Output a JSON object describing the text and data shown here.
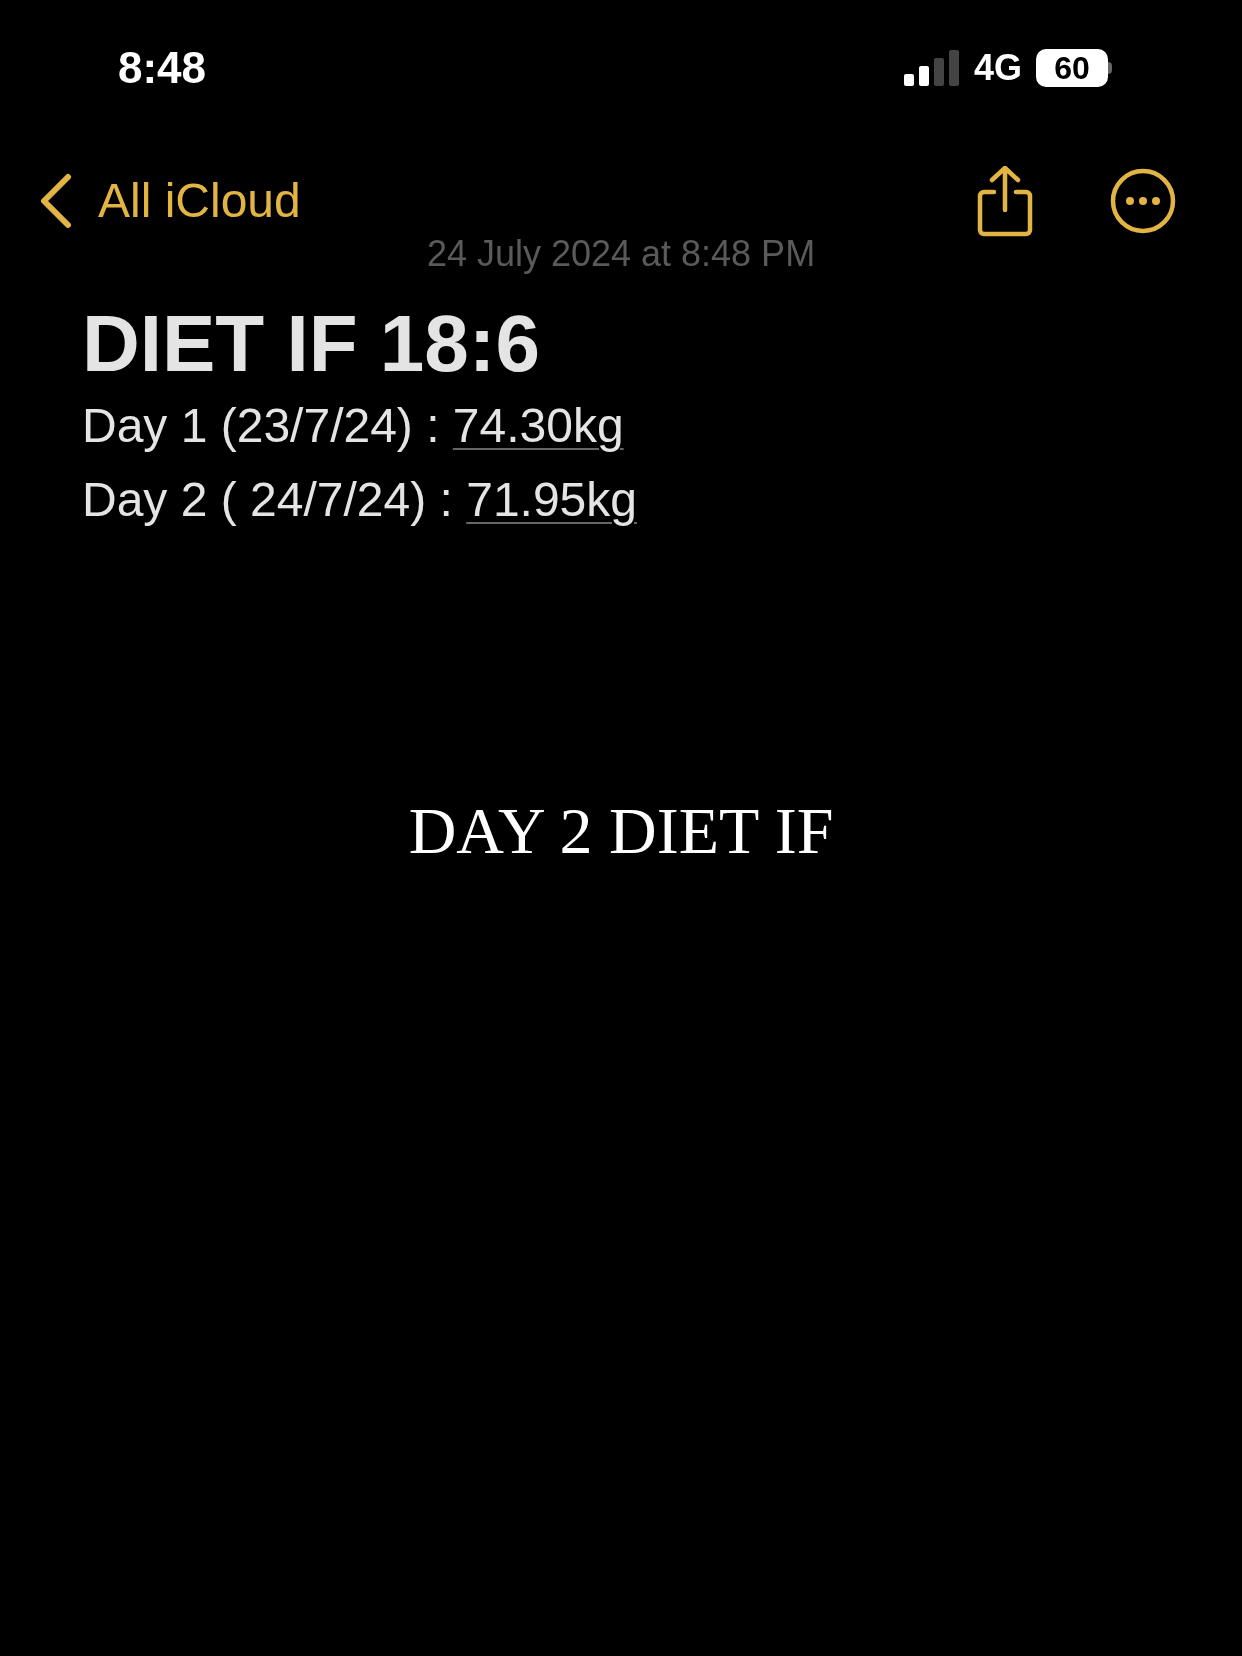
{
  "status_bar": {
    "time": "8:48",
    "network": "4G",
    "battery": "60"
  },
  "nav": {
    "back_label": "All iCloud"
  },
  "note": {
    "date": "24 July 2024 at 8:48 PM",
    "title": "DIET IF 18:6",
    "lines": [
      {
        "text": "Day 1 (23/7/24) : ",
        "weight": "74.30kg"
      },
      {
        "text": "Day 2 ( 24/7/24) : ",
        "weight": "71.95kg"
      }
    ],
    "caption": "DAY 2 DIET IF"
  }
}
